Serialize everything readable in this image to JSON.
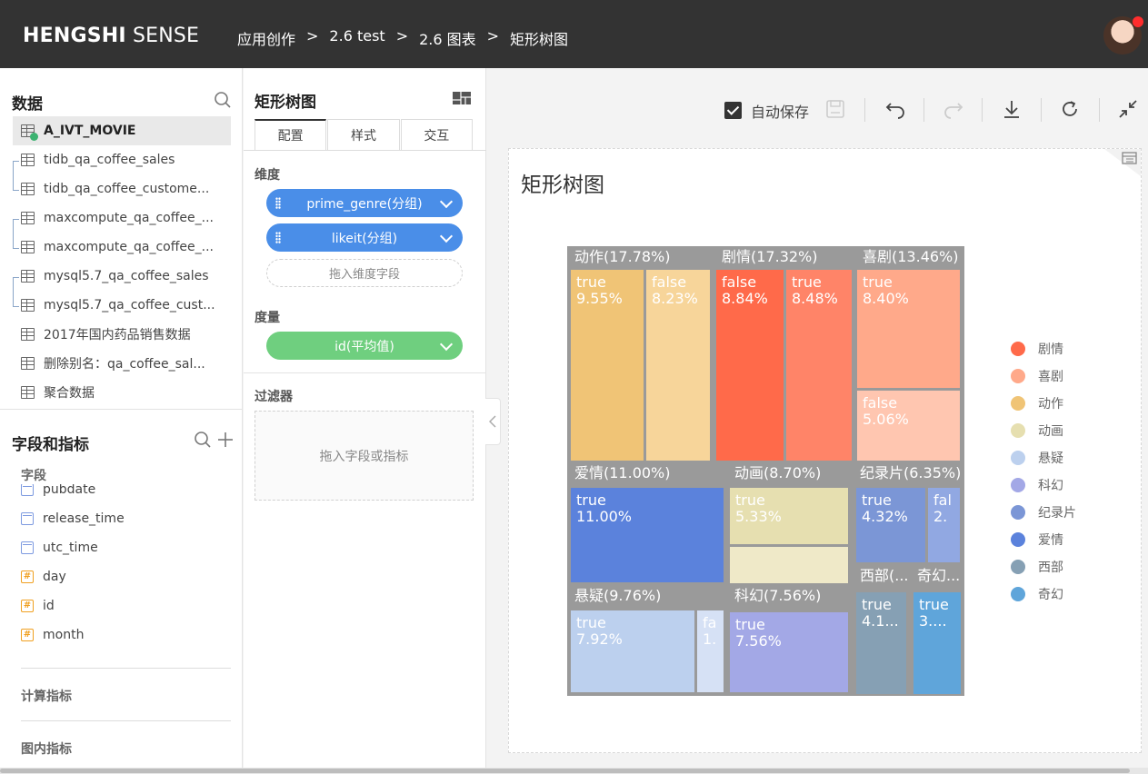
{
  "header": {
    "brand_bold": "HENGSHI",
    "brand_rest": " SENSE",
    "breadcrumb": [
      "应用创作",
      "2.6 test",
      "2.6 图表",
      "矩形树图"
    ],
    "separator": ">"
  },
  "data_panel": {
    "title": "数据",
    "datasets": [
      {
        "label": "A_IVT_MOVIE",
        "active": true
      },
      {
        "label": "tidb_qa_coffee_sales"
      },
      {
        "label": "tidb_qa_coffee_custome..."
      },
      {
        "label": "maxcompute_qa_coffee_..."
      },
      {
        "label": "maxcompute_qa_coffee_..."
      },
      {
        "label": "mysql5.7_qa_coffee_sales"
      },
      {
        "label": "mysql5.7_qa_coffee_cust..."
      },
      {
        "label": "2017年国内药品销售数据"
      },
      {
        "label": "删除别名：qa_coffee_sal..."
      },
      {
        "label": "聚合数据"
      }
    ]
  },
  "fields_panel": {
    "title": "字段和指标",
    "fields_label": "字段",
    "fields": [
      {
        "label": "pubdate",
        "type": "date"
      },
      {
        "label": "release_time",
        "type": "date"
      },
      {
        "label": "utc_time",
        "type": "date"
      },
      {
        "label": "day",
        "type": "number"
      },
      {
        "label": "id",
        "type": "number"
      },
      {
        "label": "month",
        "type": "number"
      }
    ],
    "calc_label": "计算指标",
    "chart_metrics_label": "图内指标"
  },
  "config_panel": {
    "title": "矩形树图",
    "tabs": [
      "配置",
      "样式",
      "交互"
    ],
    "dimension_label": "维度",
    "dimensions": [
      "prime_genre(分组)",
      "likeit(分组)"
    ],
    "dimension_drop": "拖入维度字段",
    "measure_label": "度量",
    "measures": [
      "id(平均值)"
    ],
    "filter_label": "过滤器",
    "filter_drop": "拖入字段或指标"
  },
  "toolbar": {
    "autosave_label": "自动保存",
    "autosave_checked": true
  },
  "chart_card": {
    "title": "矩形树图"
  },
  "chart_data": {
    "type": "treemap",
    "title": "矩形树图",
    "groups": [
      {
        "name": "动作",
        "pct": 17.78,
        "label": "动作(17.78%)",
        "color": "#f0c476",
        "children": [
          {
            "name": "true",
            "pct": 9.55,
            "label": "9.55%"
          },
          {
            "name": "false",
            "pct": 8.23,
            "label": "8.23%"
          }
        ]
      },
      {
        "name": "剧情",
        "pct": 17.32,
        "label": "剧情(17.32%)",
        "color": "#ff6a4a",
        "children": [
          {
            "name": "false",
            "pct": 8.84,
            "label": "8.84%"
          },
          {
            "name": "true",
            "pct": 8.48,
            "label": "8.48%"
          }
        ]
      },
      {
        "name": "喜剧",
        "pct": 13.46,
        "label": "喜剧(13.46%)",
        "color": "#ffa98a",
        "children": [
          {
            "name": "true",
            "pct": 8.4,
            "label": "8.40%"
          },
          {
            "name": "false",
            "pct": 5.06,
            "label": "5.06%"
          }
        ]
      },
      {
        "name": "爱情",
        "pct": 11.0,
        "label": "爱情(11.00%)",
        "color": "#5b82dc",
        "children": [
          {
            "name": "true",
            "pct": 11.0,
            "label": "11.00%"
          }
        ]
      },
      {
        "name": "动画",
        "pct": 8.7,
        "label": "动画(8.70%)",
        "color": "#e6dfb0",
        "children": [
          {
            "name": "true",
            "pct": 5.33,
            "label": "5.33%"
          },
          {
            "name": "false",
            "pct": 3.37,
            "label": ""
          }
        ]
      },
      {
        "name": "纪录片",
        "pct": 6.35,
        "label": "纪录片(6.35%)",
        "color": "#7b96d6",
        "children": [
          {
            "name": "true",
            "pct": 4.32,
            "label": "4.32%"
          },
          {
            "name": "fal",
            "pct": 2.03,
            "label": "2."
          }
        ]
      },
      {
        "name": "悬疑",
        "pct": 9.76,
        "label": "悬疑(9.76%)",
        "color": "#bcd0ee",
        "children": [
          {
            "name": "true",
            "pct": 7.92,
            "label": "7.92%"
          },
          {
            "name": "fa",
            "pct": 1.84,
            "label": "1."
          }
        ]
      },
      {
        "name": "科幻",
        "pct": 7.56,
        "label": "科幻(7.56%)",
        "color": "#a3a8e6",
        "children": [
          {
            "name": "true",
            "pct": 7.56,
            "label": "7.56%"
          }
        ]
      },
      {
        "name": "西部",
        "label": "西部(...",
        "color": "#86a0b4",
        "children": [
          {
            "name": "true",
            "label": "4.1..."
          }
        ]
      },
      {
        "name": "奇幻",
        "label": "奇幻...",
        "color": "#5fa5da",
        "children": [
          {
            "name": "true",
            "label": "3...."
          }
        ]
      }
    ],
    "legend": [
      {
        "name": "剧情",
        "color": "#ff6a4a"
      },
      {
        "name": "喜剧",
        "color": "#ffa98a"
      },
      {
        "name": "动作",
        "color": "#f0c476"
      },
      {
        "name": "动画",
        "color": "#e6dfb0"
      },
      {
        "name": "悬疑",
        "color": "#bcd0ee"
      },
      {
        "name": "科幻",
        "color": "#a3a8e6"
      },
      {
        "name": "纪录片",
        "color": "#7b96d6"
      },
      {
        "name": "爱情",
        "color": "#5b82dc"
      },
      {
        "name": "西部",
        "color": "#86a0b4"
      },
      {
        "name": "奇幻",
        "color": "#5fa5da"
      }
    ]
  }
}
